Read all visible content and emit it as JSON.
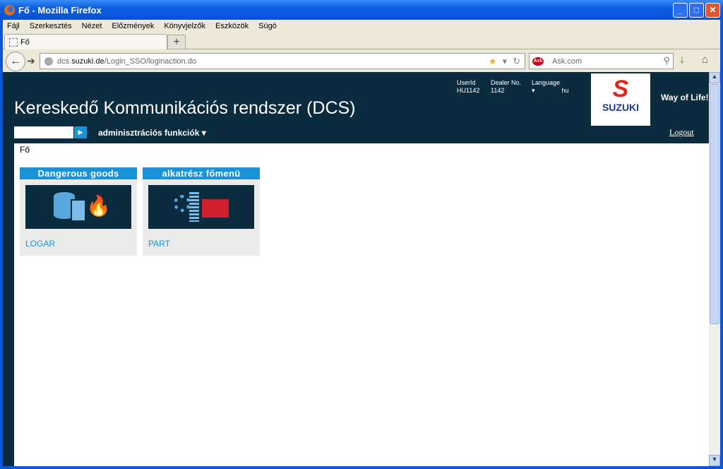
{
  "window": {
    "title": "Fő - Mozilla Firefox",
    "controls": [
      "_",
      "□",
      "✕"
    ]
  },
  "menu": [
    "Fájl",
    "Szerkesztés",
    "Nézet",
    "Előzmények",
    "Könyvjelzők",
    "Eszközök",
    "Súgó"
  ],
  "tab": {
    "label": "Fő",
    "new_tab": "+"
  },
  "nav": {
    "url_prefix": "dcs.",
    "url_domain": "suzuki.de",
    "url_path": "/Login_SSO/loginaction.do",
    "search_placeholder": "Ask.com",
    "search_engine": "Ask"
  },
  "header": {
    "title": "Kereskedő Kommunikációs rendszer (DCS)",
    "user_label": "UserId",
    "user_value": "HU1142",
    "dealer_label": "Dealer No.",
    "dealer_value": "1142",
    "language_label": "Language",
    "language_value": "hu",
    "logo_text": "SUZUKI",
    "slogan": "Way of Life!",
    "logout": "Logout",
    "admin_menu": "adminisztrációs funkciók",
    "quick_search_value": ""
  },
  "breadcrumb": "Fő",
  "tiles": [
    {
      "title": "Dangerous goods",
      "link": "LOGAR"
    },
    {
      "title": "alkatrész főmenü",
      "link": "PART"
    }
  ],
  "colors": {
    "header_bg": "#0b2c3f",
    "accent": "#1793d6",
    "brand_red": "#e2231a"
  }
}
